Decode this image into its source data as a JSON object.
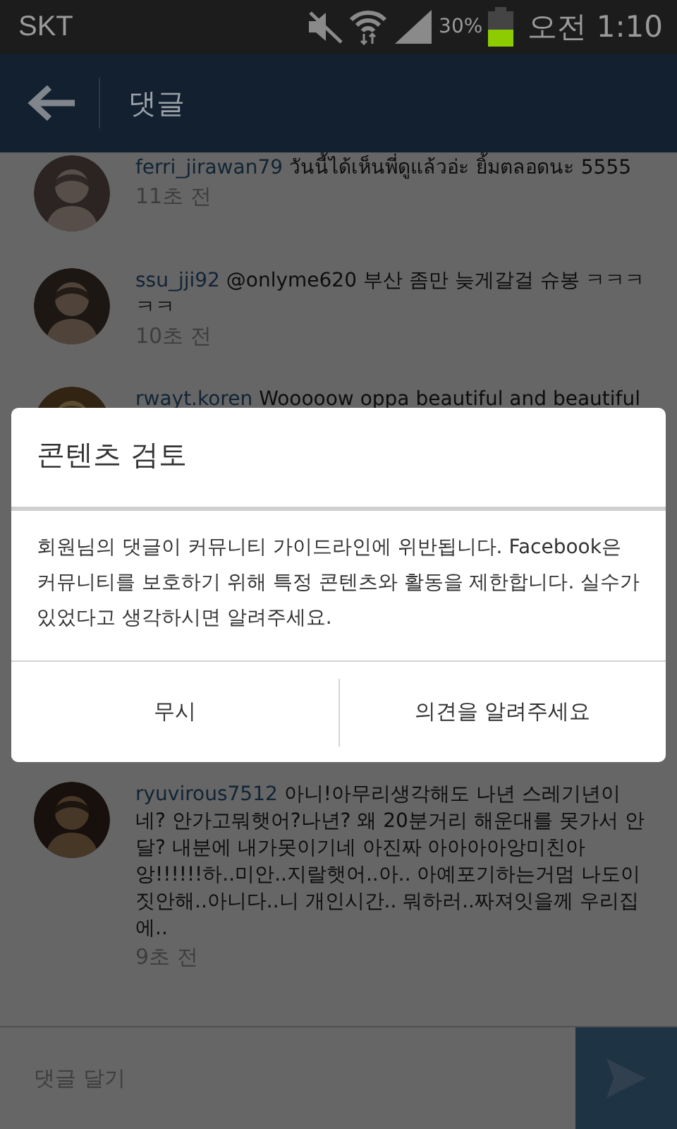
{
  "status_bar": {
    "carrier": "SKT",
    "battery_text": "30%",
    "time": "오전 1:10"
  },
  "header": {
    "title": "댓글"
  },
  "comments": [
    {
      "username": "ferri_jirawan79",
      "text": "วันนี้ได้เห็นพี่ดูแล้วอ่ะ ยิ้มตลอดนะ 5555",
      "time": "11초 전"
    },
    {
      "username": "ssu_jji92",
      "text": "@onlyme620 부산 좀만 늦게갈걸 슈봉 ㅋㅋㅋㅋㅋ",
      "time": "10초 전"
    },
    {
      "username": "rwayt.koren",
      "text": "Wooooow oppa beautiful and beautiful"
    },
    {
      "username": "ryuvirous7512",
      "text": "아니!아무리생각해도 나년 스레기년이네? 안가고뭐햇어?나년? 왜 20분거리 해운대를 못가서 안달? 내분에 내가못이기네 아진짜 아아아아앙미친아앙!!!!!!하..미안..지랄햇어..아.. 아예포기하는거멈 나도이짓안해..아니다..니 개인시간.. 뭐하러..짜져잇을께 우리집에..",
      "time": "9초 전"
    }
  ],
  "input": {
    "placeholder": "댓글 달기"
  },
  "dialog": {
    "title": "콘텐츠 검토",
    "message": "회원님의 댓글이 커뮤니티 가이드라인에 위반됩니다. Facebook은 커뮤니티를 보호하기 위해 특정 콘텐츠와 활동을 제한합니다. 실수가 있었다고 생각하시면 알려주세요.",
    "buttons": [
      "무시",
      "의견을 알려주세요"
    ]
  }
}
